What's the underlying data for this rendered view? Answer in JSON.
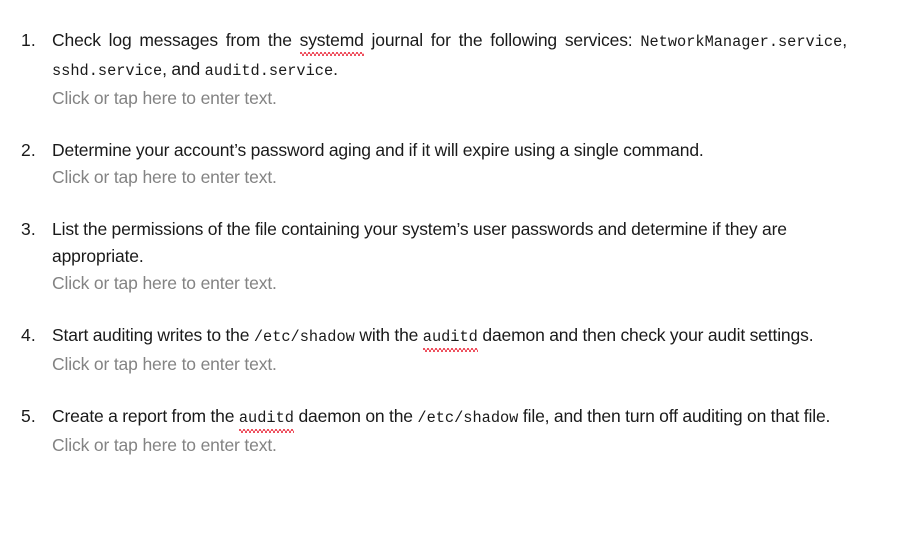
{
  "document": {
    "background_color": "#ffffff",
    "body_text_color": "#1a1a1a",
    "placeholder_color": "#838383",
    "spellcheck_underline_color": "#e8172a",
    "placeholder_label": "Click or tap here to enter text."
  },
  "questions": [
    {
      "number": "1.",
      "parts": [
        {
          "type": "text",
          "value": "Check log messages from the "
        },
        {
          "type": "misspelled",
          "value": "systemd"
        },
        {
          "type": "text",
          "value": " journal for the following services: "
        },
        {
          "type": "code",
          "value": "NetworkManager.service"
        },
        {
          "type": "text",
          "value": ", "
        },
        {
          "type": "code",
          "value": "sshd.service"
        },
        {
          "type": "text",
          "value": ", and "
        },
        {
          "type": "code",
          "value": "auditd.service"
        },
        {
          "type": "text",
          "value": "."
        }
      ],
      "plain_text": "Check log messages from the systemd journal for the following services: NetworkManager.service, sshd.service, and auditd.service.",
      "answer_placeholder": "Click or tap here to enter text."
    },
    {
      "number": "2.",
      "parts": [
        {
          "type": "text",
          "value": "Determine your account’s password aging and if it will expire using a single command."
        }
      ],
      "plain_text": "Determine your account’s password aging and if it will expire using a single command.",
      "answer_placeholder": "Click or tap here to enter text."
    },
    {
      "number": "3.",
      "parts": [
        {
          "type": "text",
          "value": "List the permissions of the file containing your system’s user passwords and determine if they are appropriate."
        }
      ],
      "plain_text": "List the permissions of the file containing your system’s user passwords and determine if they are appropriate.",
      "answer_placeholder": "Click or tap here to enter text."
    },
    {
      "number": "4.",
      "parts": [
        {
          "type": "text",
          "value": "Start auditing writes to the "
        },
        {
          "type": "code",
          "value": "/etc/shadow"
        },
        {
          "type": "text",
          "value": " with the "
        },
        {
          "type": "code-misspelled",
          "value": "auditd"
        },
        {
          "type": "text",
          "value": " daemon and then check your audit settings."
        }
      ],
      "plain_text": "Start auditing writes to the /etc/shadow with the auditd daemon and then check your audit settings.",
      "answer_placeholder": "Click or tap here to enter text."
    },
    {
      "number": "5.",
      "parts": [
        {
          "type": "text",
          "value": "Create a report from the "
        },
        {
          "type": "code-misspelled",
          "value": "auditd"
        },
        {
          "type": "text",
          "value": " daemon on the "
        },
        {
          "type": "code",
          "value": "/etc/shadow"
        },
        {
          "type": "text",
          "value": " file, and then turn off auditing on that file."
        }
      ],
      "plain_text": "Create a report from the auditd daemon on the /etc/shadow file, and then turn off auditing on that file.",
      "answer_placeholder": "Click or tap here to enter text."
    }
  ]
}
